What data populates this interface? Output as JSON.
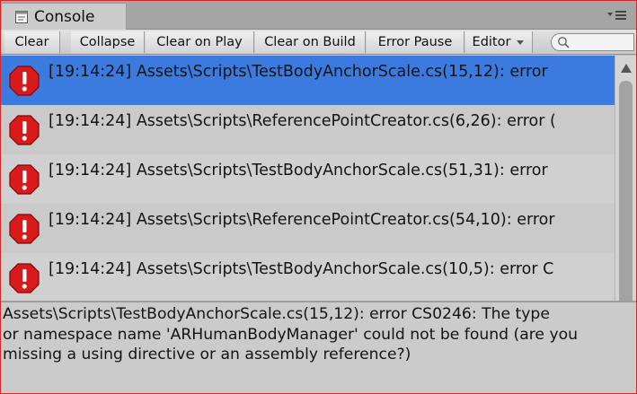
{
  "window": {
    "tab_title": "Console",
    "tab_icon": "console-window-icon",
    "tab_menu_icon": "tab-menu-icon"
  },
  "toolbar": {
    "clear_label": "Clear",
    "collapse_label": "Collapse",
    "clear_on_play_label": "Clear on Play",
    "clear_on_build_label": "Clear on Build",
    "error_pause_label": "Error Pause",
    "editor_label": "Editor",
    "search_placeholder": "",
    "search_value": ""
  },
  "log": {
    "entries": [
      {
        "text": "[19:14:24] Assets\\Scripts\\TestBodyAnchorScale.cs(15,12): error",
        "selected": true
      },
      {
        "text": "[19:14:24] Assets\\Scripts\\ReferencePointCreator.cs(6,26): error (",
        "selected": false
      },
      {
        "text": "[19:14:24] Assets\\Scripts\\TestBodyAnchorScale.cs(51,31): error",
        "selected": false
      },
      {
        "text": "[19:14:24] Assets\\Scripts\\ReferencePointCreator.cs(54,10): error",
        "selected": false
      },
      {
        "text": "[19:14:24] Assets\\Scripts\\TestBodyAnchorScale.cs(10,5): error C",
        "selected": false
      }
    ]
  },
  "detail": {
    "text": "Assets\\Scripts\\TestBodyAnchorScale.cs(15,12): error CS0246: The type\nor namespace name 'ARHumanBodyManager' could not be found (are you\nmissing a using directive or an assembly reference?)"
  },
  "colors": {
    "selection": "#3b7be0",
    "error_red": "#d91a1a",
    "window_border": "#d22a2a"
  }
}
